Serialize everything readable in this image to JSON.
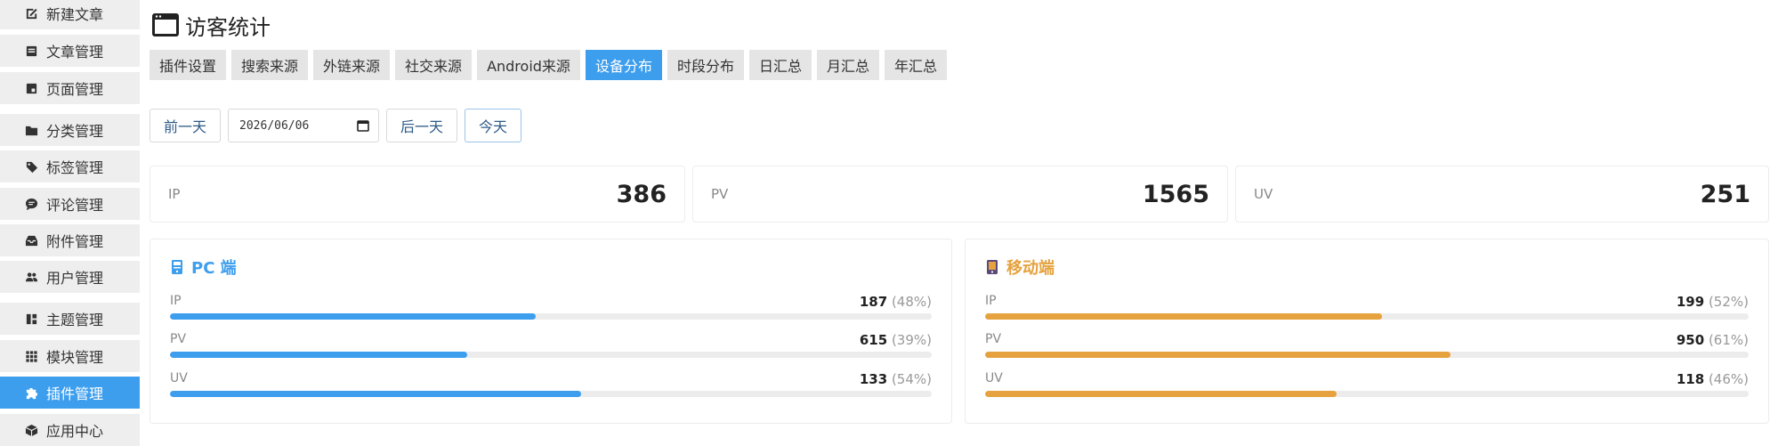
{
  "sidebar": {
    "items": [
      {
        "label": "新建文章",
        "icon": "edit-icon",
        "active": false
      },
      {
        "label": "文章管理",
        "icon": "document-icon",
        "active": false
      },
      {
        "label": "页面管理",
        "icon": "page-icon",
        "active": false
      },
      {
        "label": "分类管理",
        "icon": "folder-icon",
        "active": false
      },
      {
        "label": "标签管理",
        "icon": "tag-icon",
        "active": false
      },
      {
        "label": "评论管理",
        "icon": "comment-icon",
        "active": false
      },
      {
        "label": "附件管理",
        "icon": "inbox-icon",
        "active": false
      },
      {
        "label": "用户管理",
        "icon": "users-icon",
        "active": false
      },
      {
        "label": "主题管理",
        "icon": "layout-icon",
        "active": false
      },
      {
        "label": "模块管理",
        "icon": "grid-icon",
        "active": false
      },
      {
        "label": "插件管理",
        "icon": "puzzle-icon",
        "active": true
      },
      {
        "label": "应用中心",
        "icon": "box-icon",
        "active": false
      }
    ]
  },
  "header": {
    "title": "访客统计",
    "icon": "window-icon"
  },
  "tabs": [
    {
      "label": "插件设置",
      "active": false
    },
    {
      "label": "搜索来源",
      "active": false
    },
    {
      "label": "外链来源",
      "active": false
    },
    {
      "label": "社交来源",
      "active": false
    },
    {
      "label": "Android来源",
      "active": false
    },
    {
      "label": "设备分布",
      "active": true
    },
    {
      "label": "时段分布",
      "active": false
    },
    {
      "label": "日汇总",
      "active": false
    },
    {
      "label": "月汇总",
      "active": false
    },
    {
      "label": "年汇总",
      "active": false
    }
  ],
  "datebar": {
    "prev_label": "前一天",
    "date_value": "2026/06/06",
    "next_label": "后一天",
    "today_label": "今天"
  },
  "stats": [
    {
      "label": "IP",
      "value": "386"
    },
    {
      "label": "PV",
      "value": "1565"
    },
    {
      "label": "UV",
      "value": "251"
    }
  ],
  "panels": [
    {
      "title": "PC 端",
      "icon": "desktop-icon",
      "color": "#3d9eee",
      "metrics": [
        {
          "label": "IP",
          "value": "187",
          "pct": "(48%)",
          "fraction": 0.48
        },
        {
          "label": "PV",
          "value": "615",
          "pct": "(39%)",
          "fraction": 0.39
        },
        {
          "label": "UV",
          "value": "133",
          "pct": "(54%)",
          "fraction": 0.54
        }
      ]
    },
    {
      "title": "移动端",
      "icon": "mobile-icon",
      "color": "#e5a23e",
      "metrics": [
        {
          "label": "IP",
          "value": "199",
          "pct": "(52%)",
          "fraction": 0.52
        },
        {
          "label": "PV",
          "value": "950",
          "pct": "(61%)",
          "fraction": 0.61
        },
        {
          "label": "UV",
          "value": "118",
          "pct": "(46%)",
          "fraction": 0.46
        }
      ]
    }
  ]
}
